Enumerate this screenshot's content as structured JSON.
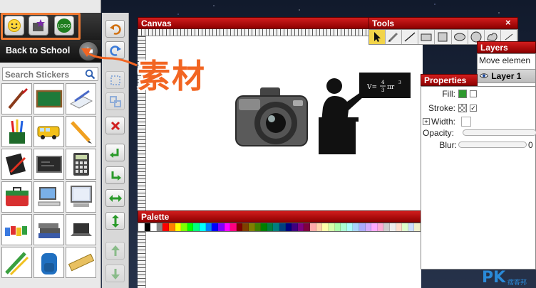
{
  "left_panel": {
    "category_title": "Back to School",
    "search_placeholder": "Search Stickers",
    "toolbar_buttons": [
      {
        "icon": "smiley-icon"
      },
      {
        "icon": "star-icon"
      },
      {
        "icon": "logo-icon",
        "label": "LOGO"
      }
    ],
    "stickers": [
      {
        "icon": "brush-icon"
      },
      {
        "icon": "chalkboard-icon"
      },
      {
        "icon": "paper-pencil-icon"
      },
      {
        "icon": "pencil-cup-icon"
      },
      {
        "icon": "school-bus-icon"
      },
      {
        "icon": "pencil-icon"
      },
      {
        "icon": "notebook-icon"
      },
      {
        "icon": "blackboard-icon"
      },
      {
        "icon": "calculator-icon"
      },
      {
        "icon": "lunchbox-icon"
      },
      {
        "icon": "computer-icon"
      },
      {
        "icon": "monitor-icon"
      },
      {
        "icon": "crayons-icon"
      },
      {
        "icon": "books-icon"
      },
      {
        "icon": "laptop-icon"
      },
      {
        "icon": "pencil-ruler-icon"
      },
      {
        "icon": "backpack-icon"
      },
      {
        "icon": "ruler-icon"
      }
    ]
  },
  "tool_column": [
    {
      "icon": "undo-icon"
    },
    {
      "icon": "redo-icon"
    },
    {
      "icon": "group-icon"
    },
    {
      "icon": "ungroup-icon"
    },
    {
      "icon": "delete-icon"
    },
    {
      "icon": "rotate-left-icon"
    },
    {
      "icon": "rotate-right-icon"
    },
    {
      "icon": "flip-horizontal-icon"
    },
    {
      "icon": "flip-vertical-icon"
    },
    {
      "icon": "bring-up-icon"
    },
    {
      "icon": "send-down-icon"
    }
  ],
  "canvas": {
    "title": "Canvas",
    "formula_v": "V=",
    "formula_num": "4",
    "formula_den": "3",
    "formula_rest": "πr",
    "formula_exp": "3"
  },
  "palette": {
    "title": "Palette",
    "colors": [
      "#ffffff",
      "#000000",
      "#ffffff",
      "#888888",
      "#ff0000",
      "#ff7f00",
      "#ffff00",
      "#7fff00",
      "#00ff00",
      "#00ff7f",
      "#00ffff",
      "#007fff",
      "#0000ff",
      "#7f00ff",
      "#ff00ff",
      "#ff007f",
      "#7f0000",
      "#7f3f00",
      "#7f7f00",
      "#3f7f00",
      "#007f00",
      "#007f3f",
      "#007f7f",
      "#003f7f",
      "#00007f",
      "#3f007f",
      "#7f007f",
      "#7f003f",
      "#ffaaaa",
      "#ffd4aa",
      "#ffffaa",
      "#d4ffaa",
      "#aaffaa",
      "#aaffd4",
      "#aaffff",
      "#aad4ff",
      "#aaaaff",
      "#d4aaff",
      "#ffaaff",
      "#ffaad4",
      "#cccccc",
      "#eeeeee",
      "#ffddcc",
      "#ddffcc",
      "#ccddff",
      "#eeeecc"
    ]
  },
  "tools": {
    "title": "Tools",
    "close_label": "×",
    "items": [
      {
        "icon": "select-arrow-icon",
        "active": true
      },
      {
        "icon": "pen-icon",
        "active": false
      },
      {
        "icon": "line-icon",
        "active": false
      },
      {
        "icon": "rect-icon",
        "active": false
      },
      {
        "icon": "square-icon",
        "active": false
      },
      {
        "icon": "ellipse-icon",
        "active": false
      },
      {
        "icon": "circle-icon",
        "active": false
      },
      {
        "icon": "freeform-icon",
        "active": false
      },
      {
        "icon": "more-icon",
        "active": false
      }
    ]
  },
  "layers": {
    "title": "Layers",
    "hint": "Move elemen",
    "layer_name": "Layer 1"
  },
  "properties": {
    "title": "Properties",
    "fill_label": "Fill:",
    "stroke_label": "Stroke:",
    "width_label": "Width:",
    "width_toggle": "+",
    "opacity_label": "Opacity:",
    "blur_label": "Blur:",
    "blur_value": "0",
    "check_mark": "✓",
    "fill_color": "#2e9a2e"
  },
  "annotation": {
    "text": "素材",
    "color": "#f26522"
  },
  "watermark": {
    "brand": "PK",
    "sub": "痞客邦"
  }
}
